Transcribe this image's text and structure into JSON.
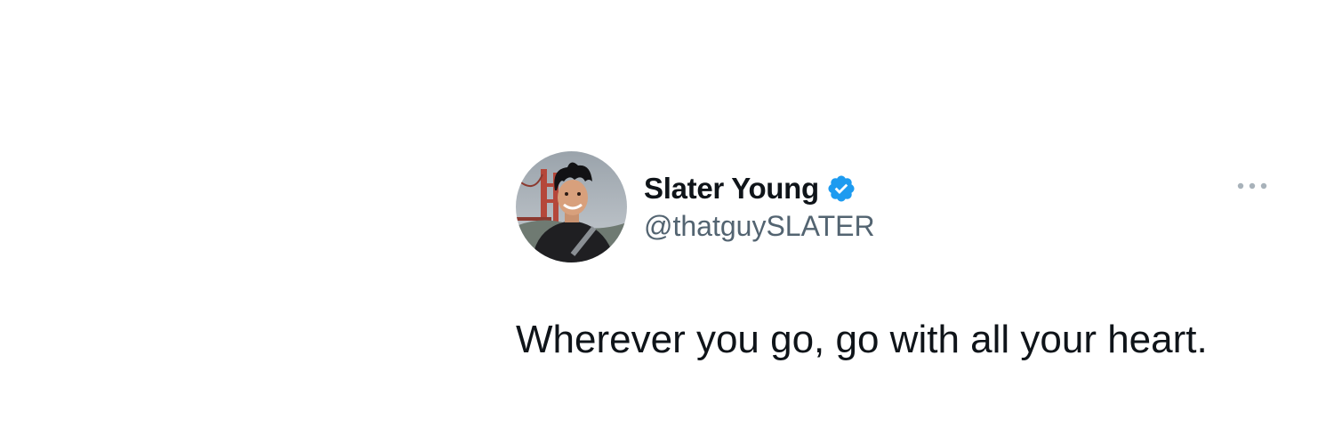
{
  "tweet": {
    "author": {
      "display_name": "Slater Young",
      "handle": "@thatguySLATER",
      "verified": true,
      "avatar_icon": "profile-photo-avatar"
    },
    "more_icon": "ellipsis-horizontal-icon",
    "text": "Wherever you go, go with all your heart."
  },
  "colors": {
    "background": "#ffffff",
    "primary_text": "#0f1419",
    "secondary_text": "#536471",
    "verified_blue": "#1d9bf0",
    "more_icon": "#a8b2ba"
  }
}
